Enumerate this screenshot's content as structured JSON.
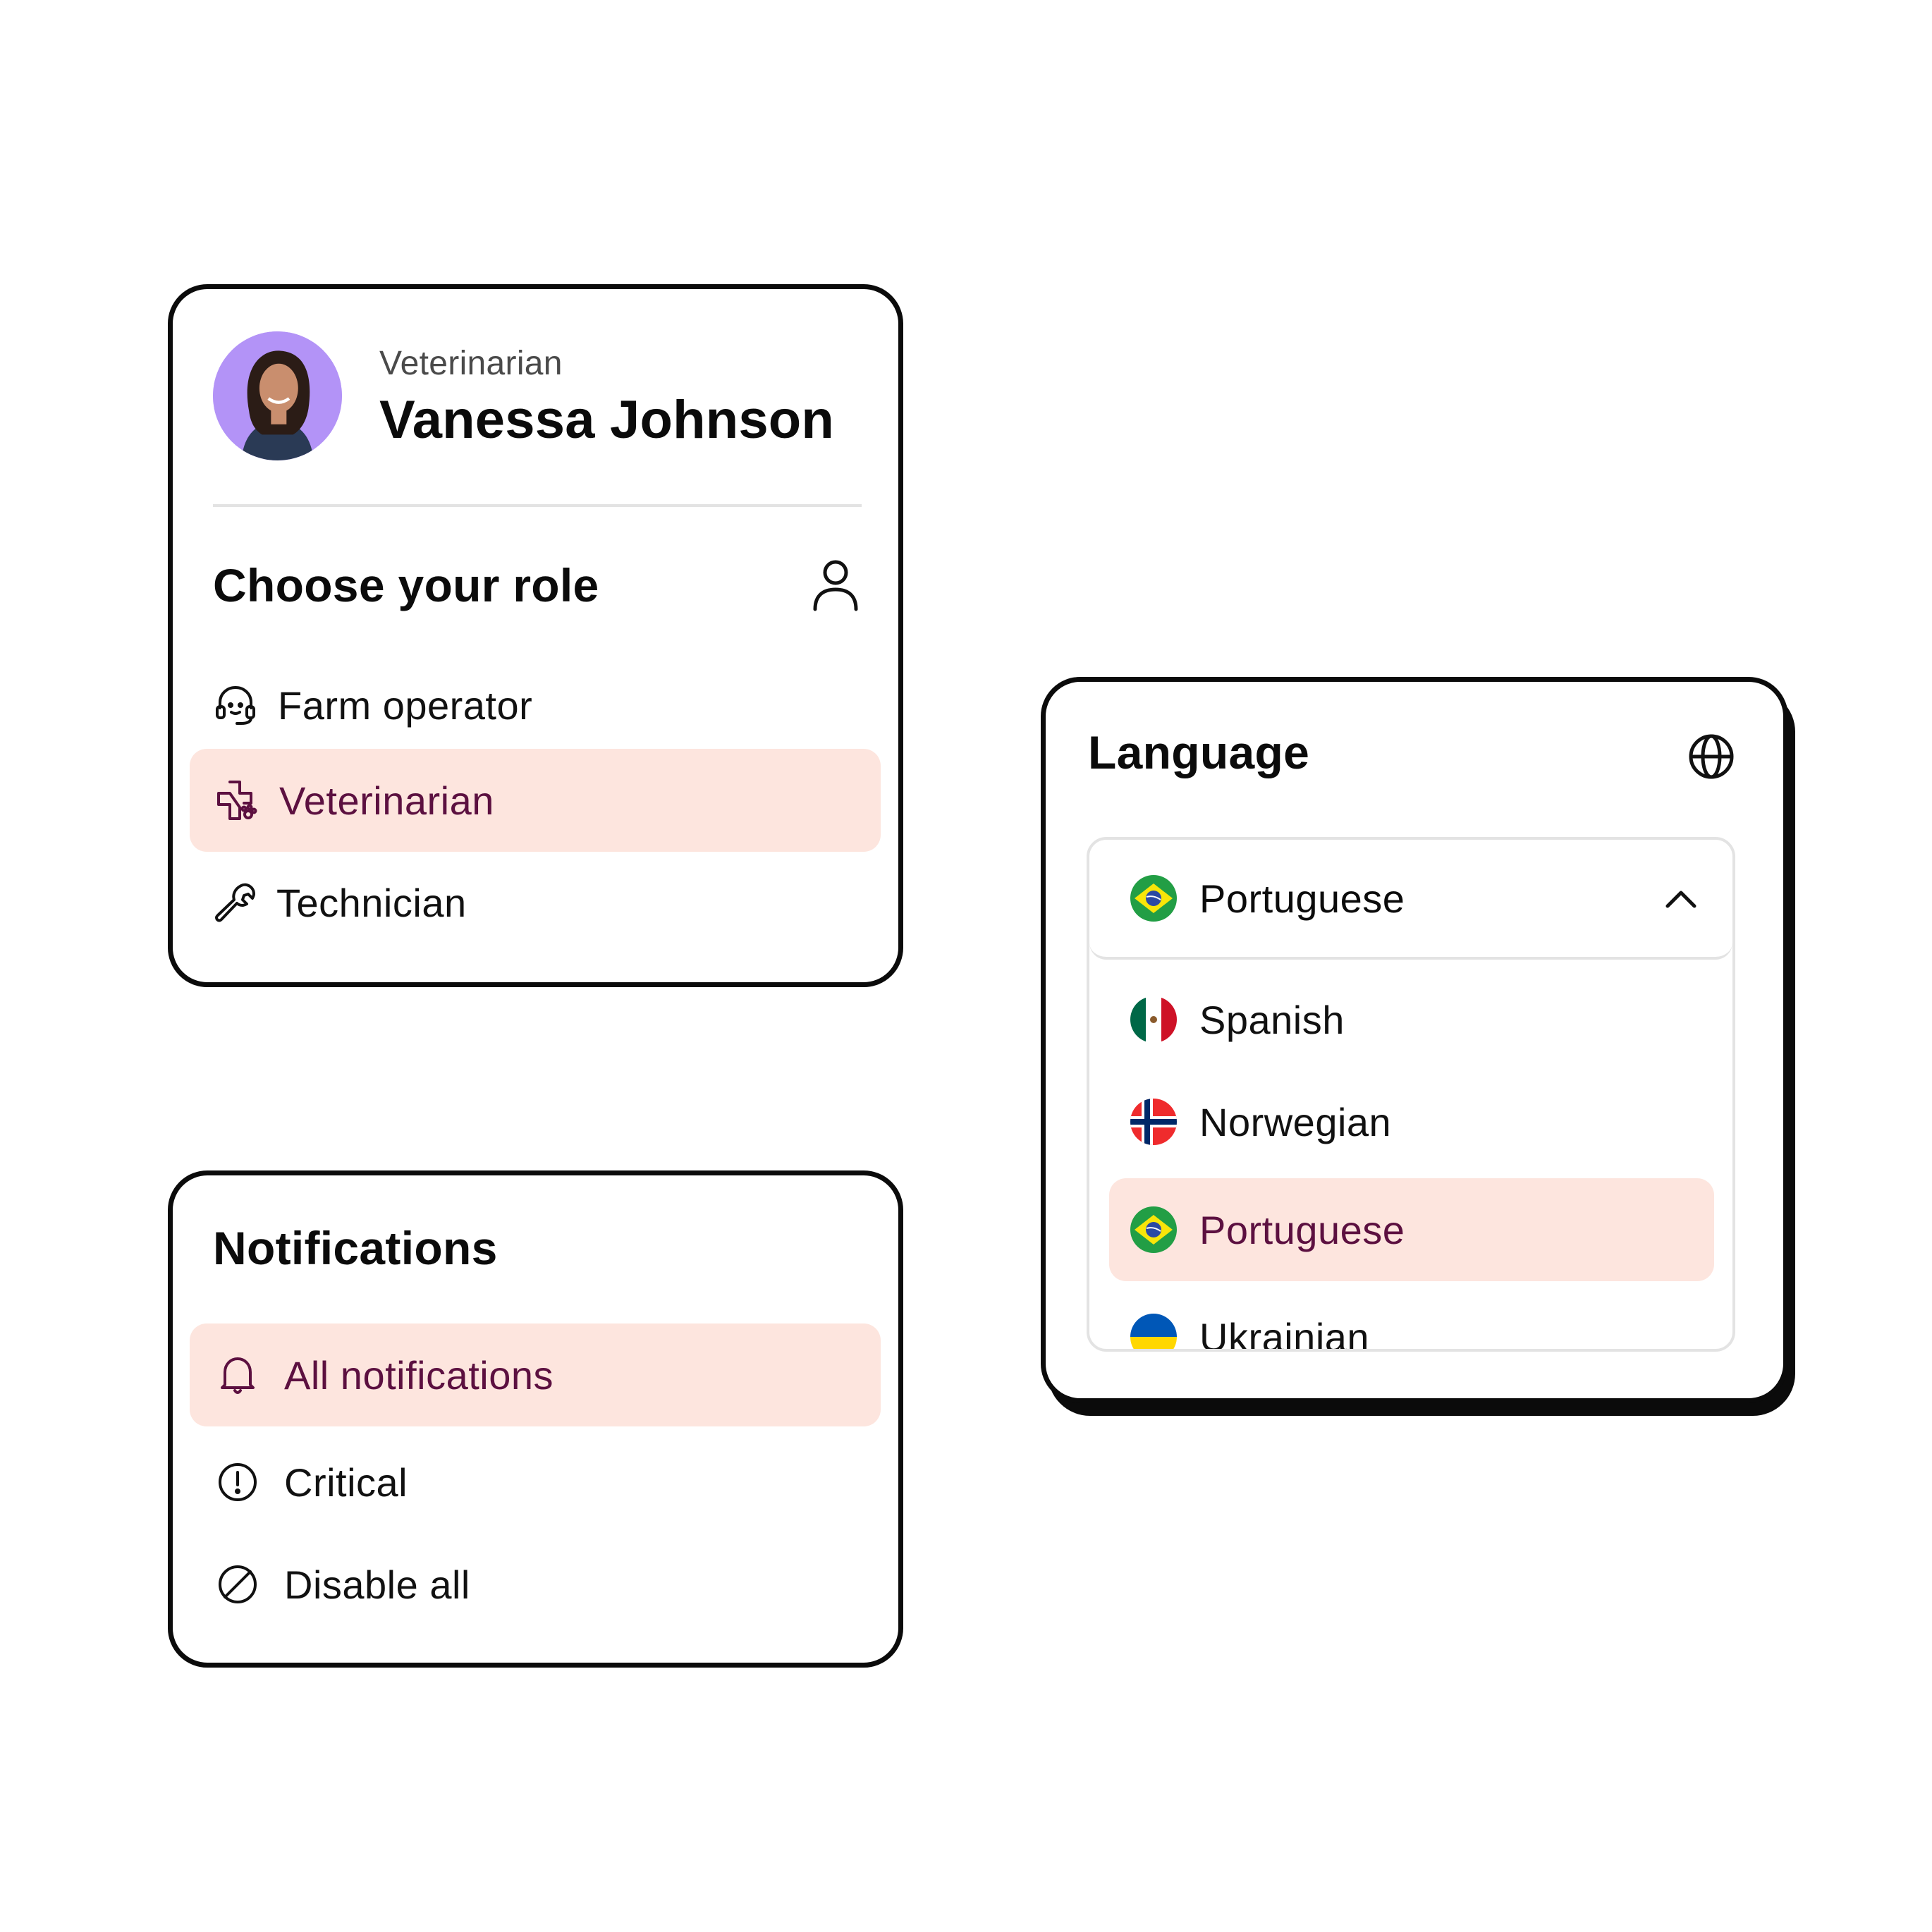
{
  "profile": {
    "role": "Veterinarian",
    "name": "Vanessa Johnson"
  },
  "role_menu": {
    "title": "Choose your role",
    "items": [
      {
        "label": "Farm operator",
        "icon": "headset-icon",
        "selected": false
      },
      {
        "label": "Veterinarian",
        "icon": "vet-paw-cross-icon",
        "selected": true
      },
      {
        "label": "Technician",
        "icon": "wrench-icon",
        "selected": false
      }
    ]
  },
  "notifications": {
    "title": "Notifications",
    "items": [
      {
        "label": "All notifications",
        "icon": "bell-icon",
        "selected": true
      },
      {
        "label": "Critical",
        "icon": "alert-circle-icon",
        "selected": false
      },
      {
        "label": "Disable all",
        "icon": "disabled-circle-icon",
        "selected": false
      }
    ]
  },
  "language": {
    "title": "Language",
    "selected": "Portuguese",
    "options": [
      {
        "label": "Spanish",
        "flag": "mexico-flag"
      },
      {
        "label": "Norwegian",
        "flag": "norway-flag"
      },
      {
        "label": "Portuguese",
        "flag": "brazil-flag",
        "selected": true
      },
      {
        "label": "Ukrainian",
        "flag": "ukraine-flag"
      }
    ]
  },
  "colors": {
    "highlight_bg": "#fde5de",
    "highlight_text": "#5c1040",
    "border": "#0b0b0b",
    "avatar_bg": "#b393f7"
  }
}
